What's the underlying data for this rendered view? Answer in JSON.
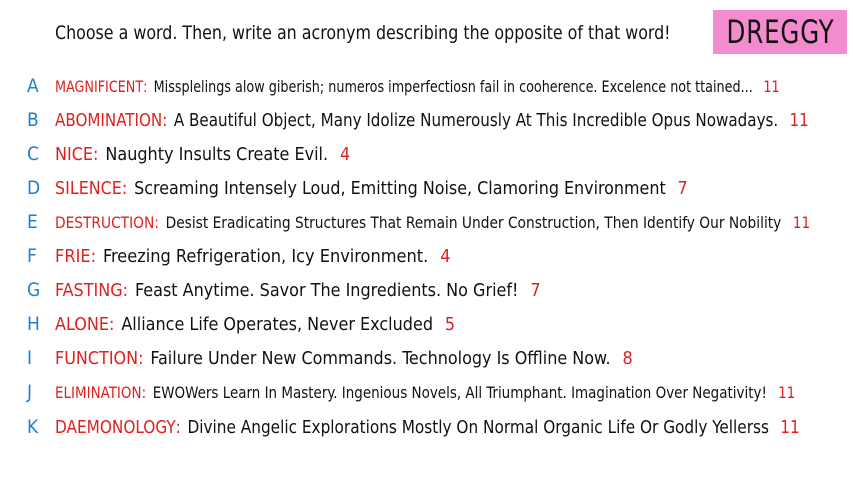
{
  "prompt": "Choose a word. Then, write an acronym describing the opposite of that word!",
  "badge": "DREGGY",
  "colors": {
    "letter": "#1e7fd0",
    "word": "#e02020",
    "text": "#111111",
    "badge_bg": "#f28ccf"
  },
  "rows": [
    {
      "letter": "A",
      "word": "MAGNIFICENT",
      "text": "Missplelings alow giberish; numeros imperfectiosn fail in cooherence. Excelence not ttained...",
      "count": "11"
    },
    {
      "letter": "B",
      "word": "ABOMINATION",
      "text": "A Beautiful Object, Many Idolize Numerously At This Incredible Opus Nowadays.",
      "count": "11"
    },
    {
      "letter": "C",
      "word": "NICE",
      "text": "Naughty Insults Create Evil.",
      "count": "4"
    },
    {
      "letter": "D",
      "word": "SILENCE",
      "text": "Screaming Intensely Loud,  Emitting Noise, Clamoring Environment",
      "count": "7"
    },
    {
      "letter": "E",
      "word": "DESTRUCTION",
      "text": "Desist Eradicating Structures That Remain Under Construction, Then Identify Our Nobility",
      "count": "11"
    },
    {
      "letter": "F",
      "word": "FRIE",
      "text": "Freezing Refrigeration, Icy Environment.",
      "count": "4"
    },
    {
      "letter": "G",
      "word": "FASTING",
      "text": "Feast Anytime. Savor The Ingredients. No Grief!",
      "count": "7"
    },
    {
      "letter": "H",
      "word": "ALONE",
      "text": "Alliance Life Operates, Never Excluded",
      "count": "5"
    },
    {
      "letter": "I",
      "word": "FUNCTION",
      "text": "Failure Under New Commands. Technology Is Offline Now.",
      "count": "8"
    },
    {
      "letter": "J",
      "word": "ELIMINATION",
      "text": "EWOWers Learn In Mastery. Ingenious Novels, All Triumphant. Imagination Over Negativity!",
      "count": "11"
    },
    {
      "letter": "K",
      "word": "DAEMONOLOGY",
      "text": "Divine Angelic Explorations Mostly On Normal Organic Life Or Godly Yellerss",
      "count": "11"
    }
  ]
}
